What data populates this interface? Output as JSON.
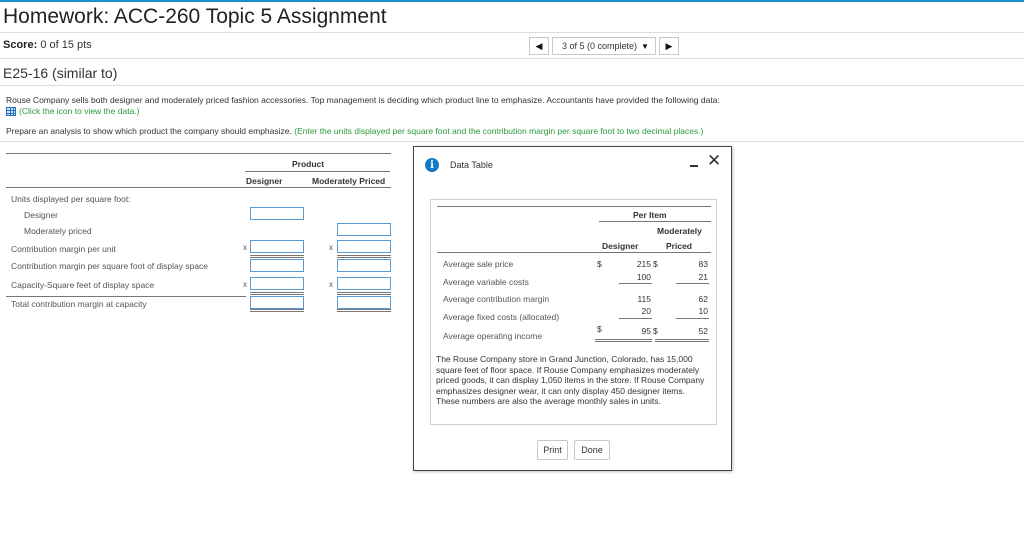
{
  "header": {
    "title": "Homework: ACC-260 Topic 5 Assignment",
    "score_label": "Score:",
    "score_value": "0 of 15 pts"
  },
  "pager": {
    "prev_icon": "◀",
    "next_icon": "▶",
    "selected": "3 of 5 (0 complete)",
    "dropdown_icon": "▼"
  },
  "question": {
    "id": "E25-16 (similar to)",
    "prompt": "Rouse Company sells both designer and moderately priced fashion accessories. Top management is deciding which product line to emphasize. Accountants have provided the following data:",
    "data_link": "(Click the icon to view the data.)",
    "instruction": "Prepare an analysis to show which product the company should emphasize.",
    "instruction_note": "(Enter the units displayed per square foot and the contribution margin per square foot to two decimal places.)"
  },
  "answer_table": {
    "group_header": "Product",
    "col_designer": "Designer",
    "col_moderate": "Moderately Priced",
    "rows": {
      "units_header": "Units displayed per square foot:",
      "designer": "Designer",
      "moderate": "Moderately priced",
      "cm_unit": "Contribution margin per unit",
      "cm_sqft": "Contribution margin per square foot of display space",
      "capacity": "Capacity-Square feet of display space",
      "total_cm": "Total contribution margin at capacity"
    },
    "x_symbol": "x"
  },
  "modal": {
    "title": "Data Table",
    "info_icon": "i",
    "minimize_icon": "minimize-icon",
    "close_icon": "✕",
    "per_item": "Per Item",
    "col_designer": "Designer",
    "col_moderate_1": "Moderately",
    "col_moderate_2": "Priced",
    "currency": "$",
    "rows": [
      {
        "label": "Average sale price",
        "designer": "215",
        "moderate": "83",
        "dollar": true
      },
      {
        "label": "Average variable costs",
        "designer": "100",
        "moderate": "21",
        "dollar": false
      },
      {
        "label": "Average contribution margin",
        "designer": "115",
        "moderate": "62",
        "dollar": false
      },
      {
        "label": "Average fixed costs (allocated)",
        "designer": "20",
        "moderate": "10",
        "dollar": false
      },
      {
        "label": "Average operating income",
        "designer": "95",
        "moderate": "52",
        "dollar": true
      }
    ],
    "paragraph": "The Rouse Company store in Grand Junction, Colorado, has 15,000 square feet of floor space. If Rouse Company emphasizes moderately priced goods, it can display 1,050 items in the store. If Rouse Company emphasizes designer wear, it can only display 450 designer items. These numbers are also the average monthly sales in units.",
    "print_label": "Print",
    "done_label": "Done"
  },
  "colors": {
    "accent": "#1a8fc9",
    "link_green": "#2a9a3a",
    "input_border": "#5b9bd5",
    "info_blue": "#1479c7"
  }
}
